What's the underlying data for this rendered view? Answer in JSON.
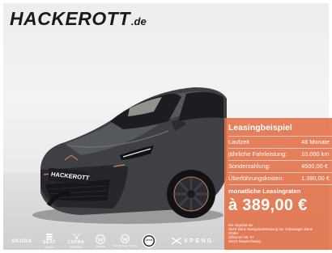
{
  "logo": {
    "main": "HACKEROTT",
    "suffix": ".de"
  },
  "plate": {
    "text": "HACKEROTT"
  },
  "leasing": {
    "title": "Leasingbeispiel",
    "rows": [
      {
        "label": "Laufzeit",
        "value": "48 Monate"
      },
      {
        "label": "jährliche Fahrleistung:",
        "value": "10.000 km"
      },
      {
        "label": "Sonderzahlung:",
        "value": "4500,00 €"
      },
      {
        "label": "Überführungskosten:",
        "value": "1.390,00 €"
      }
    ],
    "monthly_label": "monatliche Leasingraten",
    "price": "à 389,00 €",
    "offer_lines": [
      "Ein Angebot der",
      "SEAT Bank Zweigniederlassung der Volkswagen Bank",
      "GmbH",
      "Gifhorner Str. 57",
      "38112 Braunschweig"
    ]
  },
  "brands": [
    {
      "name": "SKODA",
      "sub": ""
    },
    {
      "name": "SEAT",
      "sub": "Service"
    },
    {
      "name": "CUPRA",
      "sub": "SERVICE"
    },
    {
      "name": "",
      "sub": "Service"
    },
    {
      "name": "",
      "sub": "Nutzfahrzeuge Service"
    },
    {
      "name": "LOTUS",
      "sub": ""
    },
    {
      "name": "XPENG",
      "sub": ""
    }
  ]
}
